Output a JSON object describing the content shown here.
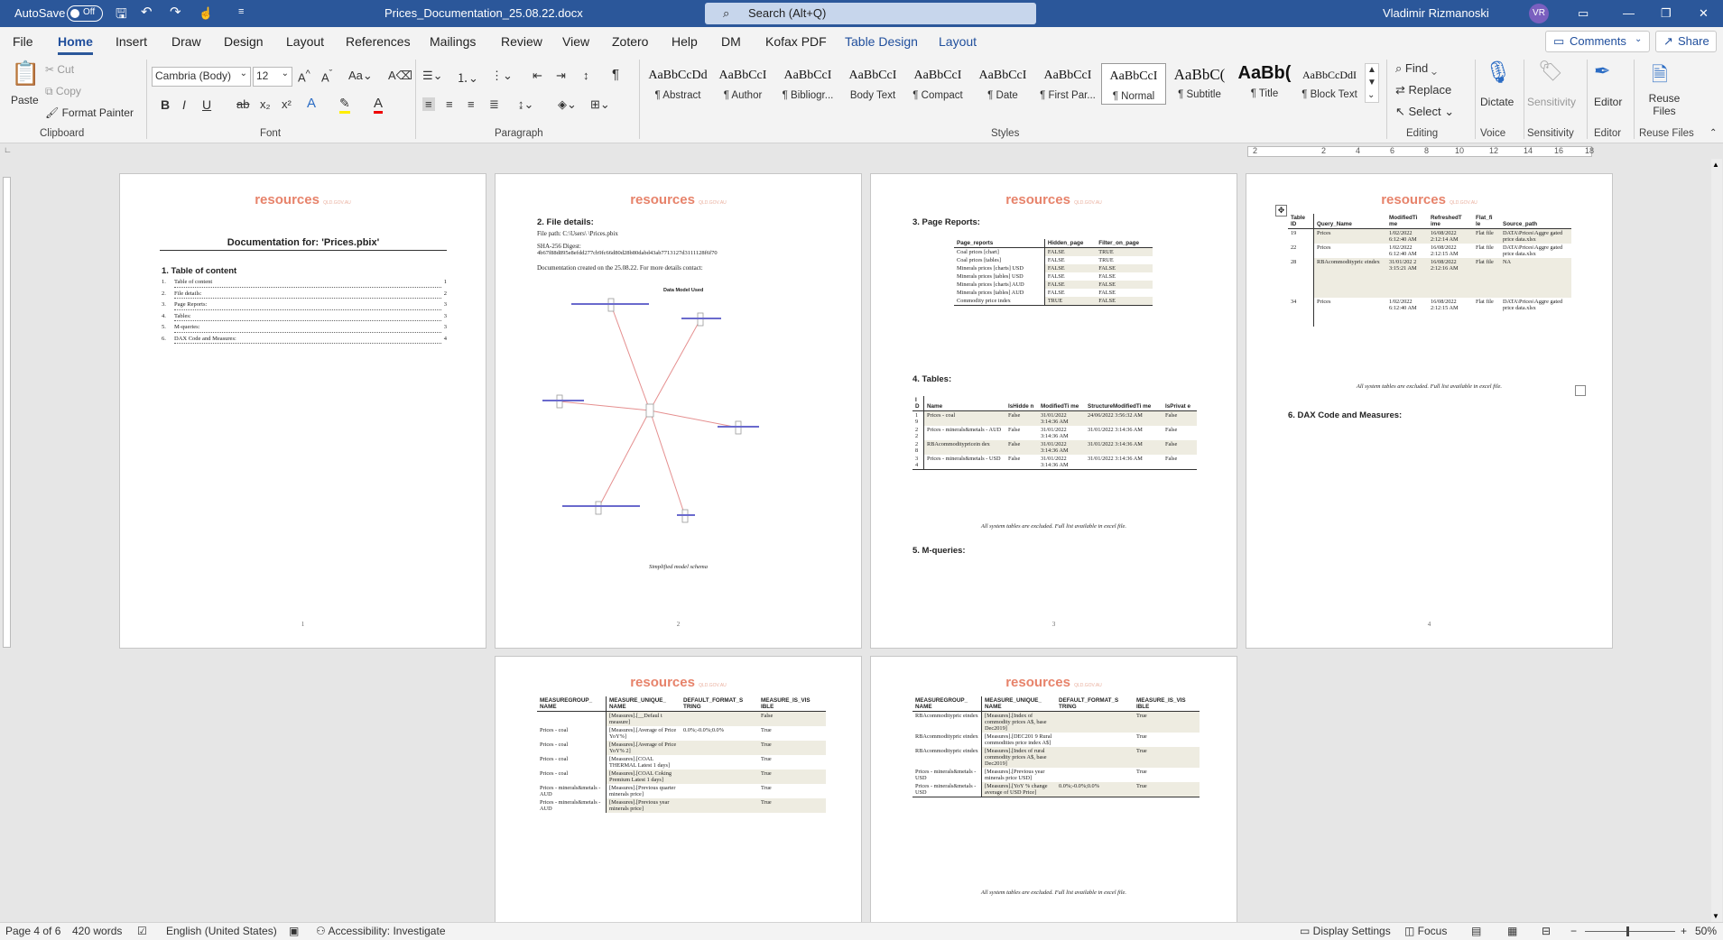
{
  "titlebar": {
    "autosave": "AutoSave",
    "toggle": "Off",
    "doc_title": "Prices_Documentation_25.08.22.docx",
    "search_placeholder": "Search (Alt+Q)",
    "user_name": "Vladimir Rizmanoski",
    "initials": "VR"
  },
  "menu": {
    "tabs": [
      "File",
      "Home",
      "Insert",
      "Draw",
      "Design",
      "Layout",
      "References",
      "Mailings",
      "Review",
      "View",
      "Zotero",
      "Help",
      "DM",
      "Kofax PDF",
      "Table Design",
      "Layout"
    ],
    "comments": "Comments",
    "share": "Share"
  },
  "ribbon": {
    "clipboard": {
      "paste": "Paste",
      "cut": "Cut",
      "copy": "Copy",
      "format_painter": "Format Painter",
      "label": "Clipboard"
    },
    "font": {
      "family": "Cambria (Body)",
      "size": "12",
      "label": "Font"
    },
    "paragraph": {
      "label": "Paragraph"
    },
    "styles": {
      "label": "Styles",
      "items": [
        {
          "sample": "AaBbCcDd",
          "name": "¶ Abstract"
        },
        {
          "sample": "AaBbCcI",
          "name": "¶ Author"
        },
        {
          "sample": "AaBbCcI",
          "name": "¶ Bibliogr..."
        },
        {
          "sample": "AaBbCcI",
          "name": "Body Text"
        },
        {
          "sample": "AaBbCcI",
          "name": "¶ Compact"
        },
        {
          "sample": "AaBbCcI",
          "name": "¶ Date"
        },
        {
          "sample": "AaBbCcI",
          "name": "¶ First Par..."
        },
        {
          "sample": "AaBbCcI",
          "name": "¶ Normal"
        },
        {
          "sample": "AaBbC(",
          "name": "¶ Subtitle"
        },
        {
          "sample": "AaBb(",
          "name": "¶ Title"
        },
        {
          "sample": "AaBbCcDdI",
          "name": "¶ Block Text"
        }
      ]
    },
    "editing": {
      "find": "Find",
      "replace": "Replace",
      "select": "Select",
      "label": "Editing"
    },
    "voice": {
      "dictate": "Dictate",
      "label": "Voice"
    },
    "sensitivity": {
      "button": "Sensitivity",
      "label": "Sensitivity"
    },
    "editor": {
      "button": "Editor",
      "label": "Editor"
    },
    "reuse": {
      "button": "Reuse Files",
      "label": "Reuse Files"
    }
  },
  "ruler": {
    "ticks": [
      "2",
      "2",
      "4",
      "6",
      "8",
      "10",
      "12",
      "14",
      "16",
      "18"
    ]
  },
  "header": {
    "brand": "resources",
    "tagline": "QLD.GOV.AU"
  },
  "page1": {
    "title": "Documentation for: 'Prices.pbix'",
    "toc_heading": "1.  Table of content",
    "toc": [
      {
        "n": "1.",
        "t": "Table of content",
        "p": "1"
      },
      {
        "n": "2.",
        "t": "File details:",
        "p": "2"
      },
      {
        "n": "3.",
        "t": "Page Reports:",
        "p": "3"
      },
      {
        "n": "4.",
        "t": "Tables:",
        "p": "3"
      },
      {
        "n": "5.",
        "t": "M-queries:",
        "p": "3"
      },
      {
        "n": "6.",
        "t": "DAX Code and Measures:",
        "p": "4"
      }
    ],
    "page_number": "1"
  },
  "page2": {
    "heading": "2.  File details:",
    "file_path": "File path: C:\\Users\\  \\Prices.pbix",
    "sha_label": "SHA-256 Digest:",
    "sha": "4b67f88d895e8efdd277cb9fc66d80d28b80dabd43ab7713127d3111128f6f70",
    "created": "Documentation created on the 25.08.22. For more details contact:",
    "diagram_title": "Data Model Used",
    "caption": "Simplified model schema",
    "page_number": "2"
  },
  "page3": {
    "heading_reports": "3.  Page Reports:",
    "reports_columns": [
      "Page_reports",
      "Hidden_page",
      "Filter_on_page"
    ],
    "reports_rows": [
      [
        "Coal prices [chart]",
        "FALSE",
        "TRUE"
      ],
      [
        "Coal prices [tables]",
        "FALSE",
        "TRUE"
      ],
      [
        "Minerals prices [charts] USD",
        "FALSE",
        "FALSE"
      ],
      [
        "Minerals prices [tables] USD",
        "FALSE",
        "FALSE"
      ],
      [
        "Minerals prices [charts] AUD",
        "FALSE",
        "FALSE"
      ],
      [
        "Minerals prices [tables] AUD",
        "FALSE",
        "FALSE"
      ],
      [
        "Commodity price index",
        "TRUE",
        "FALSE"
      ]
    ],
    "heading_tables": "4.  Tables:",
    "tables_columns": [
      "I D",
      "Name",
      "IsHidde n",
      "ModifiedTi me",
      "StructureModifiedTi me",
      "IsPrivat e"
    ],
    "tables_rows": [
      [
        "1 9",
        "Prices - coal",
        "False",
        "31/01/2022 3:14:36 AM",
        "24/06/2022 3:56:32 AM",
        "False"
      ],
      [
        "2 2",
        "Prices - minerals&metals - AUD",
        "False",
        "31/01/2022 3:14:36 AM",
        "31/01/2022 3:14:36 AM",
        "False"
      ],
      [
        "2 8",
        "RBAcommoditypricein dex",
        "False",
        "31/01/2022 3:14:36 AM",
        "31/01/2022 3:14:36 AM",
        "False"
      ],
      [
        "3 4",
        "Prices - minerals&metals - USD",
        "False",
        "31/01/2022 3:14:36 AM",
        "31/01/2022 3:14:36 AM",
        "False"
      ]
    ],
    "tables_caption": "All system tables are excluded. Full list available in excel file.",
    "heading_mq": "5.  M-queries:",
    "page_number": "3"
  },
  "page4": {
    "columns": [
      "Table ID",
      "Query_Name",
      "ModifiedTi me",
      "RefreshedT ime",
      "Flat_fi le",
      "Source_path"
    ],
    "rows": [
      [
        "19",
        "Prices",
        "1/02/2022 6:12:40 AM",
        "16/08/2022 2:12:14 AM",
        "Flat file",
        "DATA\\Prices\\Aggre gated price data.xlsx"
      ],
      [
        "22",
        "Prices",
        "1/02/2022 6:12:40 AM",
        "16/08/2022 2:12:15 AM",
        "Flat file",
        "DATA\\Prices\\Aggre gated price data.xlsx"
      ],
      [
        "28",
        "RBAcommoditypric eindex",
        "31/01/202 2 3:15:21 AM",
        "16/08/2022 2:12:16 AM",
        "Flat file",
        "NA"
      ],
      [
        "34",
        "Prices",
        "1/02/2022 6:12:40 AM",
        "16/08/2022 2:12:15 AM",
        "Flat file",
        "DATA\\Prices\\Aggre gated price data.xlsx"
      ]
    ],
    "caption": "All system tables are excluded. Full list available in excel file.",
    "heading_dax": "6.  DAX Code and Measures:",
    "page_number": "4"
  },
  "page5": {
    "columns": [
      "MEASUREGROUP_ NAME",
      "MEASURE_UNIQUE_ NAME",
      "DEFAULT_FORMAT_S TRING",
      "MEASURE_IS_VIS IBLE"
    ],
    "rows": [
      [
        "",
        "[Measures].[__Defaul t measure]",
        "",
        "False"
      ],
      [
        "Prices - coal",
        "[Measures].[Average of Price YoY%]",
        "0.0%;-0.0%;0.0%",
        "True"
      ],
      [
        "Prices - coal",
        "[Measures].[Average of Price YoY% 2]",
        "",
        "True"
      ],
      [
        "Prices - coal",
        "[Measures].[COAL THERMAL Latest 1 days]",
        "",
        "True"
      ],
      [
        "Prices - coal",
        "[Measures].[COAL Coking Premium Latest 1 days]",
        "",
        "True"
      ],
      [
        "Prices - minerals&metals - AUD",
        "[Measures].[Previous quarter minerals price]",
        "",
        "True"
      ],
      [
        "Prices - minerals&metals - AUD",
        "[Measures].[Previous year minerals price]",
        "",
        "True"
      ]
    ]
  },
  "page6": {
    "columns": [
      "MEASUREGROUP_ NAME",
      "MEASURE_UNIQUE_ NAME",
      "DEFAULT_FORMAT_S TRING",
      "MEASURE_IS_VIS IBLE"
    ],
    "rows": [
      [
        "RBAcommoditypric eindex",
        "[Measures].[Index of commodity prices A$, base Dec2019]",
        "",
        "True"
      ],
      [
        "RBAcommoditypric eindex",
        "[Measures].[DEC201 9 Rural commodities price index A$]",
        "",
        "True"
      ],
      [
        "RBAcommoditypric eindex",
        "[Measures].[Index of rural commodity prices A$, base Dec2019]",
        "",
        "True"
      ],
      [
        "Prices - minerals&metals - USD",
        "[Measures].[Previous year minerals price USD]",
        "",
        "True"
      ],
      [
        "Prices - minerals&metals - USD",
        "[Measures].[YoY % change average of USD Price]",
        "0.0%;-0.0%;0.0%",
        "True"
      ]
    ],
    "caption": "All system tables are excluded. Full list available in excel file."
  },
  "status": {
    "page": "Page 4 of 6",
    "words": "420 words",
    "language": "English (United States)",
    "accessibility": "Accessibility: Investigate",
    "display": "Display Settings",
    "focus": "Focus",
    "zoom": "50%"
  }
}
